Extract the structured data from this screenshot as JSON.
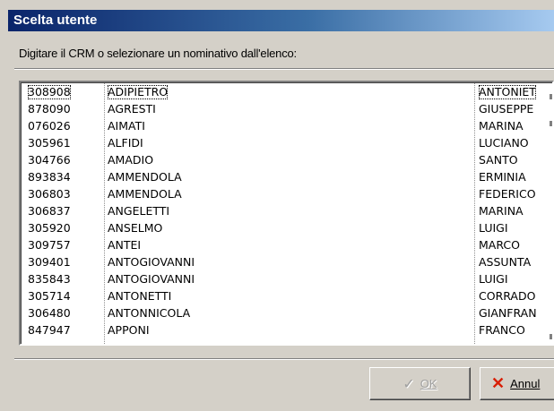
{
  "dialog": {
    "title": "Scelta utente",
    "instruction": "Digitare il CRM o selezionare un nominativo dall'elenco:"
  },
  "list": {
    "rows": [
      {
        "code": "308908",
        "surname": "ADIPIETRO",
        "name": "ANTONIET"
      },
      {
        "code": "878090",
        "surname": "AGRESTI",
        "name": "GIUSEPPE"
      },
      {
        "code": "076026",
        "surname": "AIMATI",
        "name": "MARINA"
      },
      {
        "code": "305961",
        "surname": "ALFIDI",
        "name": "LUCIANO"
      },
      {
        "code": "304766",
        "surname": "AMADIO",
        "name": "SANTO"
      },
      {
        "code": "893834",
        "surname": "AMMENDOLA",
        "name": "ERMINIA"
      },
      {
        "code": "306803",
        "surname": "AMMENDOLA",
        "name": "FEDERICO"
      },
      {
        "code": "306837",
        "surname": "ANGELETTI",
        "name": "MARINA"
      },
      {
        "code": "305920",
        "surname": "ANSELMO",
        "name": "LUIGI"
      },
      {
        "code": "309757",
        "surname": "ANTEI",
        "name": "MARCO"
      },
      {
        "code": "309401",
        "surname": "ANTOGIOVANNI",
        "name": "ASSUNTA"
      },
      {
        "code": "835843",
        "surname": "ANTOGIOVANNI",
        "name": "LUIGI"
      },
      {
        "code": "305714",
        "surname": "ANTONETTI",
        "name": "CORRADO"
      },
      {
        "code": "306480",
        "surname": "ANTONNICOLA",
        "name": "GIANFRAN"
      },
      {
        "code": "847947",
        "surname": "APPONI",
        "name": "FRANCO"
      }
    ]
  },
  "buttons": {
    "ok_label": "OK",
    "cancel_label": "Annul"
  },
  "icons": {
    "ok": "check-icon",
    "cancel": "x-icon"
  },
  "colors": {
    "title_start": "#0a246a",
    "title_end": "#a6caf0",
    "cancel_icon": "#d81e05"
  }
}
